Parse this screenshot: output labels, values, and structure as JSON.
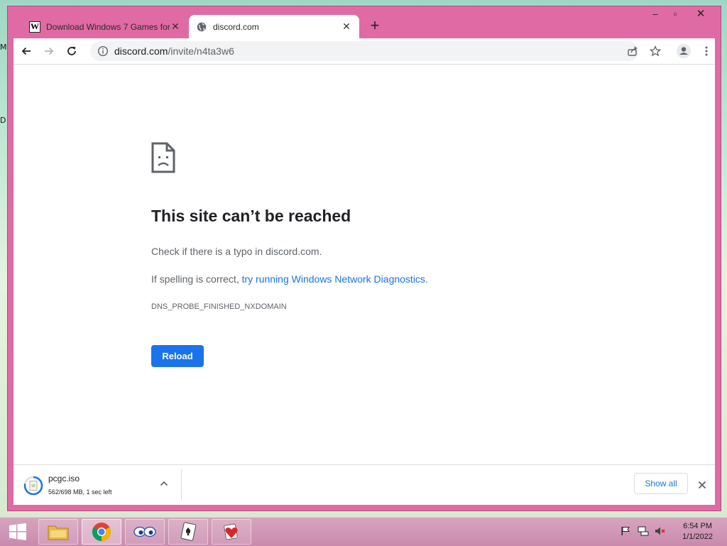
{
  "browser": {
    "tabs": [
      {
        "title": "Download Windows 7 Games for",
        "favicon": "w-logo-icon",
        "active": false
      },
      {
        "title": "discord.com",
        "favicon": "globe-icon",
        "active": true
      }
    ],
    "favicon_letter": "W",
    "address": {
      "domain": "discord.com",
      "path": "/invite/n4ta3w6"
    }
  },
  "error_page": {
    "title": "This site can’t be reached",
    "line1": "Check if there is a typo in discord.com.",
    "line2_prefix": "If spelling is correct, ",
    "line2_link": "try running Windows Network Diagnostics",
    "line2_suffix": ".",
    "error_code": "DNS_PROBE_FINISHED_NXDOMAIN",
    "reload_label": "Reload"
  },
  "downloads": {
    "file_name": "pcgc.iso",
    "status": "562/698 MB, 1 sec left",
    "show_all_label": "Show all"
  },
  "desktop": {
    "edge_letters": [
      "M",
      "D"
    ]
  },
  "taskbar": {
    "time": "6:54 PM",
    "date": "1/1/2022"
  },
  "colors": {
    "accent": "#1a73e8",
    "window_frame": "#e06aa4"
  }
}
